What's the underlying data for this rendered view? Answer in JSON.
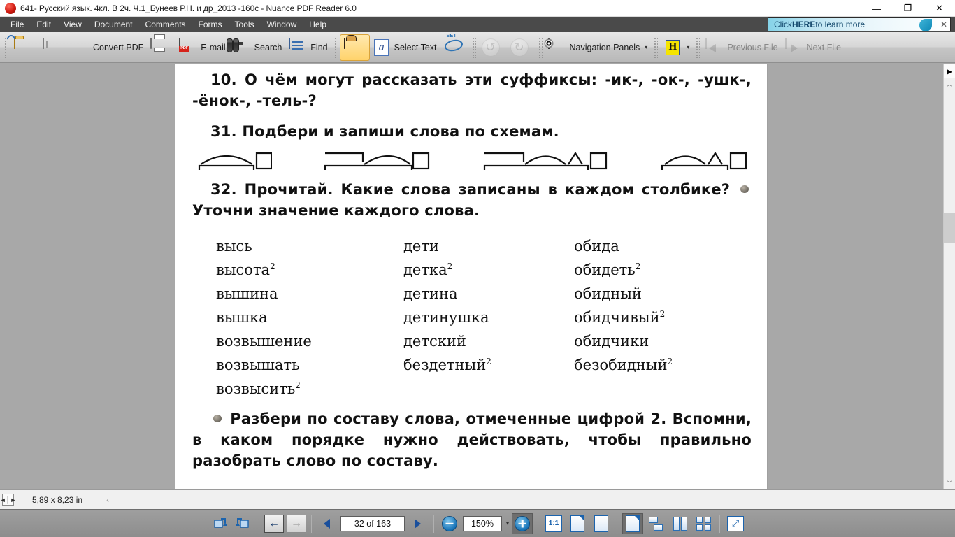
{
  "window": {
    "title": "641- Русский язык. 4кл. В 2ч. Ч.1_Бунеев Р.Н. и др_2013 -160с - Nuance PDF Reader 6.0",
    "minimize": "—",
    "maximize": "❐",
    "close": "✕"
  },
  "menubar": {
    "items": [
      {
        "label": "File"
      },
      {
        "label": "Edit"
      },
      {
        "label": "View"
      },
      {
        "label": "Document"
      },
      {
        "label": "Comments"
      },
      {
        "label": "Forms"
      },
      {
        "label": "Tools"
      },
      {
        "label": "Window"
      },
      {
        "label": "Help"
      }
    ]
  },
  "promo": {
    "prefix": "Click ",
    "strong": "HERE",
    "suffix": " to learn more",
    "close": "✕"
  },
  "toolbar": {
    "open_label": "",
    "save_label": "",
    "convert_label": "Convert PDF",
    "print_label": "",
    "email_label": "E-mail",
    "search_label": "Search",
    "find_label": "Find",
    "hand_label": "",
    "select_text_label": "Select Text",
    "set_label": "",
    "undo_label": "",
    "redo_label": "",
    "nav_panels_label": "Navigation Panels",
    "nav_panels_caret": "▾",
    "highlight_label": "H",
    "highlight_caret": "▾",
    "previous_file_label": "Previous File",
    "next_file_label": "Next File"
  },
  "document": {
    "task10": {
      "number": "10.",
      "text": "О чём могут рассказать эти суффиксы: -ик-, -ок-, -ушк-, -ёнок-, -тель-?"
    },
    "task31": {
      "number": "31.",
      "text": "Подбери и запиши слова по схемам."
    },
    "task32": {
      "number": "32.",
      "text_before": "Прочитай. Какие слова записаны в каждом столбике?",
      "text_after": "Уточни значение каждого слова."
    },
    "columns": [
      {
        "words": [
          {
            "text": "высь",
            "mark": ""
          },
          {
            "text": "высота",
            "mark": "2"
          },
          {
            "text": "вышина",
            "mark": ""
          },
          {
            "text": "вышка",
            "mark": ""
          },
          {
            "text": "возвышение",
            "mark": ""
          },
          {
            "text": "возвышать",
            "mark": ""
          },
          {
            "text": "возвысить",
            "mark": "2"
          }
        ]
      },
      {
        "words": [
          {
            "text": "дети",
            "mark": ""
          },
          {
            "text": "детка",
            "mark": "2"
          },
          {
            "text": "детина",
            "mark": ""
          },
          {
            "text": "детинушка",
            "mark": ""
          },
          {
            "text": "детский",
            "mark": ""
          },
          {
            "text": "бездетный",
            "mark": "2"
          }
        ]
      },
      {
        "words": [
          {
            "text": "обида",
            "mark": ""
          },
          {
            "text": "обидеть",
            "mark": "2"
          },
          {
            "text": "обидный",
            "mark": ""
          },
          {
            "text": "обидчивый",
            "mark": "2"
          },
          {
            "text": "обидчики",
            "mark": ""
          },
          {
            "text": "безобидный",
            "mark": "2"
          }
        ]
      }
    ],
    "closing": {
      "text": "Разбери по составу слова, отмеченные цифрой 2. Вспомни, в каком порядке нужно действовать, чтобы правильно разобрать слово по составу."
    }
  },
  "statusbar": {
    "page_size": "5,89 x 8,23 in",
    "collapse_arrow": "‹"
  },
  "bottombar": {
    "rotate_ccw": "",
    "rotate_cw": "",
    "prev_view": "←",
    "next_view": "→",
    "prev_page": "◀",
    "page_indicator": "32 of 163",
    "next_page": "▶",
    "zoom_out": "−",
    "zoom_value": "150%",
    "zoom_caret": "▾",
    "zoom_in": "+",
    "actual_size": "1:1",
    "fit_page": "",
    "fit_width": "",
    "single_page": "",
    "continuous": "",
    "facing": "",
    "continuous_facing": "",
    "fullscreen": "⤢"
  },
  "colors": {
    "accent_blue": "#1b63ad",
    "menu_bg": "#4a4a4a",
    "workarea_bg": "#a8a8a8",
    "active_tool": "#ffd36b"
  }
}
